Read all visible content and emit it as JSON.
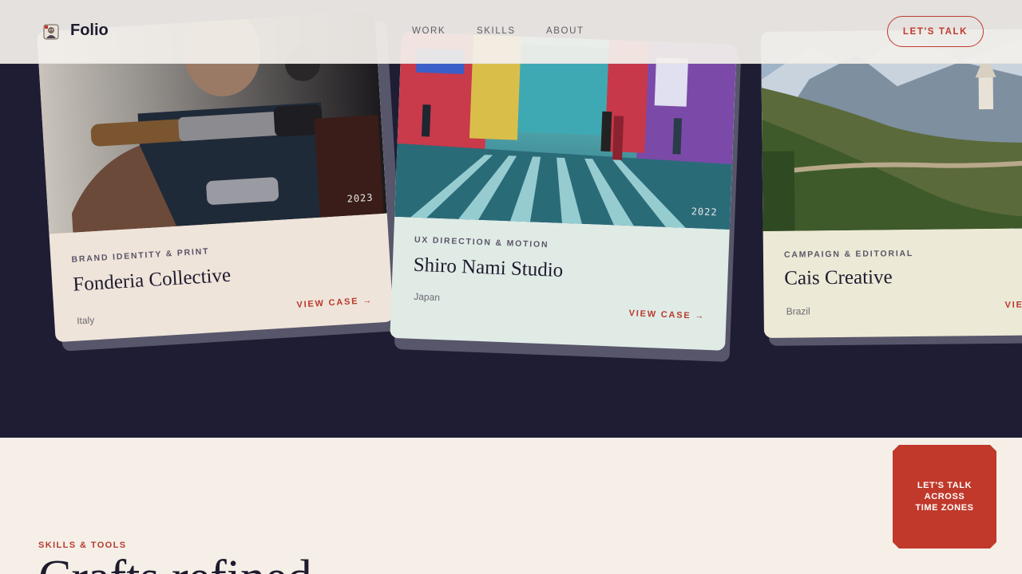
{
  "header": {
    "brand": "Folio",
    "nav": [
      {
        "label": "WORK"
      },
      {
        "label": "SKILLS"
      },
      {
        "label": "ABOUT"
      }
    ],
    "cta_label": "LET'S TALK"
  },
  "cards": [
    {
      "year": "2023",
      "category": "BRAND IDENTITY & PRINT",
      "title": "Fonderia Collective",
      "country": "Italy",
      "link_label": "VIEW CASE →"
    },
    {
      "year": "2022",
      "category": "UX DIRECTION & MOTION",
      "title": "Shiro Nami Studio",
      "country": "Japan",
      "link_label": "VIEW CASE →"
    },
    {
      "year": "",
      "category": "CAMPAIGN & EDITORIAL",
      "title": "Cais Creative",
      "country": "Brazil",
      "link_label": "VIEW CASE →"
    }
  ],
  "skills": {
    "eyebrow": "SKILLS & TOOLS",
    "heading": "Crafts refined"
  },
  "badge": {
    "text": "LET'S TALK\nACROSS\nTIME ZONES"
  },
  "colors": {
    "accent": "#c0392b",
    "band": "#1f1d33",
    "page_bg": "#f5efe8",
    "card1_bg": "#efe4da",
    "card2_bg": "#e0ebe6",
    "card3_bg": "#ece9d6"
  },
  "icons": {
    "logo": "portrait-logo-icon",
    "arrow": "arrow-right-icon"
  }
}
